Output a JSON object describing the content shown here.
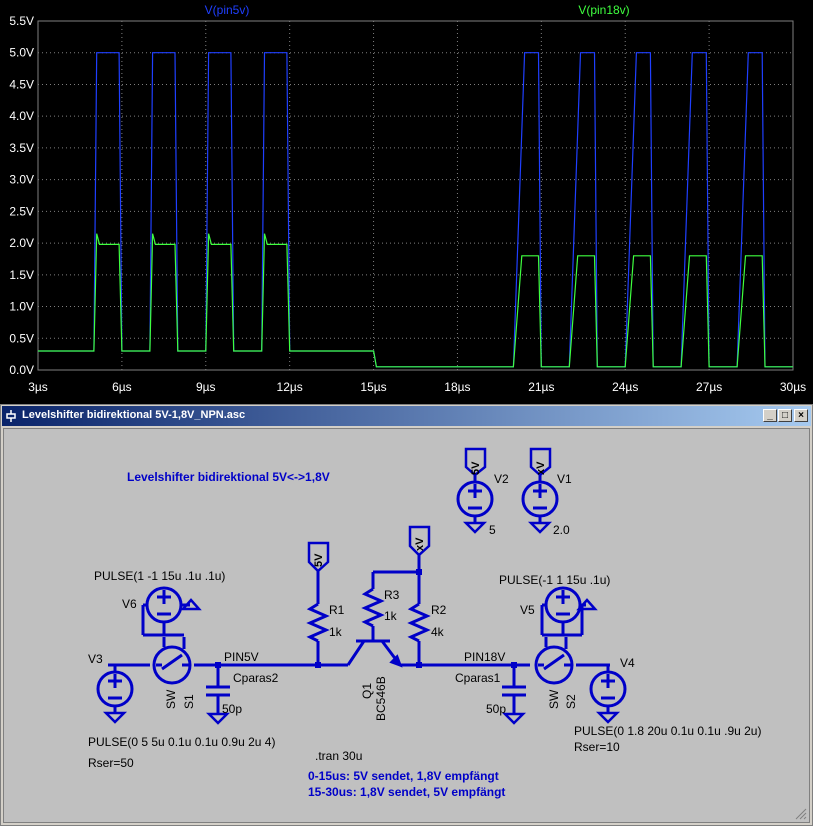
{
  "plot": {
    "trace1_name": "V(pin5v)",
    "trace2_name": "V(pin18v)",
    "y_ticks": [
      "5.5V",
      "5.0V",
      "4.5V",
      "4.0V",
      "3.5V",
      "3.0V",
      "2.5V",
      "2.0V",
      "1.5V",
      "1.0V",
      "0.5V",
      "0.0V"
    ],
    "x_ticks": [
      "3µs",
      "6µs",
      "9µs",
      "12µs",
      "15µs",
      "18µs",
      "21µs",
      "24µs",
      "27µs",
      "30µs"
    ],
    "colors": {
      "background": "#000000",
      "grid": "#7f7f7f",
      "trace1": "#1f3fff",
      "trace2": "#3fff3f",
      "text": "#ffffff"
    }
  },
  "chart_data": {
    "type": "line",
    "title": "",
    "xlabel": "",
    "ylabel": "",
    "x_unit": "µs",
    "xlim": [
      3,
      30
    ],
    "ylim": [
      0,
      5.5
    ],
    "grid": true,
    "legend": "top",
    "series": [
      {
        "name": "V(pin5v)",
        "x": [
          3,
          5,
          5.1,
          5.9,
          6,
          7,
          7.1,
          7.9,
          8,
          9,
          9.1,
          9.9,
          10,
          11,
          11.1,
          11.9,
          12,
          15,
          15.1,
          20,
          20.4,
          20.9,
          21,
          22,
          22.4,
          22.9,
          23,
          24,
          24.4,
          24.9,
          25,
          26,
          26.4,
          26.9,
          27,
          28,
          28.4,
          28.9,
          29,
          30
        ],
        "y": [
          0.3,
          0.3,
          5.0,
          5.0,
          0.3,
          0.3,
          5.0,
          5.0,
          0.3,
          0.3,
          5.0,
          5.0,
          0.3,
          0.3,
          5.0,
          5.0,
          0.3,
          0.3,
          0.05,
          0.05,
          5.0,
          5.0,
          0.05,
          0.05,
          5.0,
          5.0,
          0.05,
          0.05,
          5.0,
          5.0,
          0.05,
          0.05,
          5.0,
          5.0,
          0.05,
          0.05,
          5.0,
          5.0,
          0.05,
          0.05
        ]
      },
      {
        "name": "V(pin18v)",
        "x": [
          3,
          5,
          5.1,
          5.2,
          5.9,
          6,
          7,
          7.1,
          7.2,
          7.9,
          8,
          9,
          9.1,
          9.2,
          9.9,
          10,
          11,
          11.1,
          11.2,
          11.9,
          12,
          15,
          15.1,
          20,
          20.3,
          20.9,
          21,
          22,
          22.3,
          22.9,
          23,
          24,
          24.3,
          24.9,
          25,
          26,
          26.3,
          26.9,
          27,
          28,
          28.3,
          28.9,
          29,
          30
        ],
        "y": [
          0.3,
          0.3,
          2.15,
          1.98,
          1.98,
          0.3,
          0.3,
          2.15,
          1.98,
          1.98,
          0.3,
          0.3,
          2.15,
          1.98,
          1.98,
          0.3,
          0.3,
          2.15,
          1.98,
          1.98,
          0.3,
          0.3,
          0.05,
          0.05,
          1.8,
          1.8,
          0.05,
          0.05,
          1.8,
          1.8,
          0.05,
          0.05,
          1.8,
          1.8,
          0.05,
          0.05,
          1.8,
          1.8,
          0.05,
          0.05,
          1.8,
          1.8,
          0.05,
          0.05
        ]
      }
    ]
  },
  "window": {
    "title": "Levelshifter bidirektional 5V-1,8V_NPN.asc",
    "minimize": "_",
    "maximize": "□",
    "close": "×"
  },
  "schematic": {
    "heading": "Levelshifter bidirektional 5V<->1,8V",
    "flags": {
      "v5_top": "5V",
      "xv_top": "xV",
      "r1_flag": "5V",
      "r2_flag": "xV"
    },
    "v2": {
      "name": "V2",
      "value": "5"
    },
    "v1": {
      "name": "V1",
      "value": "2.0"
    },
    "v6": {
      "name": "V6",
      "pulse": "PULSE(1 -1 15u .1u .1u)"
    },
    "v5": {
      "name": "V5",
      "pulse": "PULSE(-1 1 15u .1u)"
    },
    "v3": {
      "name": "V3",
      "pulse": "PULSE(0 5 5u 0.1u 0.1u 0.9u 2u 4)",
      "rser": "Rser=50"
    },
    "v4": {
      "name": "V4",
      "pulse": "PULSE(0 1.8 20u 0.1u 0.1u .9u 2u)",
      "rser": "Rser=10"
    },
    "s1": {
      "name": "S1",
      "model": "SW"
    },
    "s2": {
      "name": "S2",
      "model": "SW"
    },
    "r1": {
      "name": "R1",
      "value": "1k"
    },
    "r2": {
      "name": "R2",
      "value": "4k"
    },
    "r3": {
      "name": "R3",
      "value": "1k"
    },
    "q1": {
      "name": "Q1",
      "model": "BC546B"
    },
    "cparas2": {
      "name": "Cparas2",
      "value": "50p"
    },
    "cparas1": {
      "name": "Cparas1",
      "value": "50p"
    },
    "net_pin5v": "PIN5V",
    "net_pin18v": "PIN18V",
    "tran": ".tran 30u",
    "comment1": "0-15us:  5V sendet, 1,8V empfängt",
    "comment2": "15-30us:  1,8V sendet, 5V empfängt"
  }
}
